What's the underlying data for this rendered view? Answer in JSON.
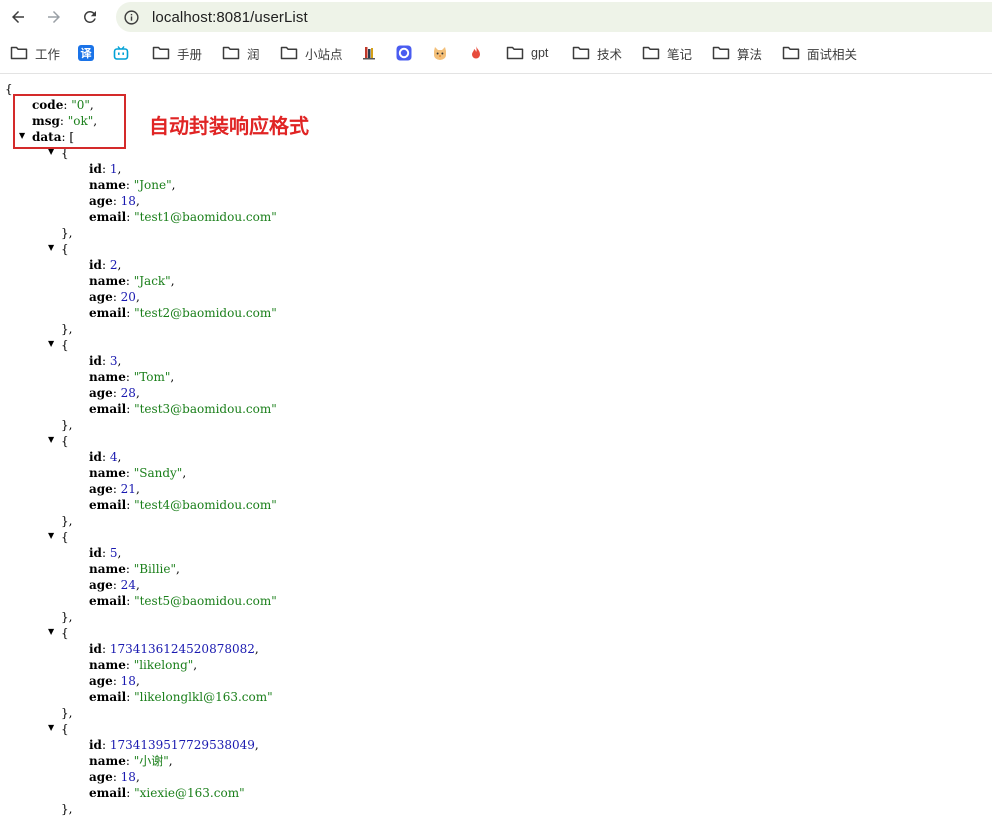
{
  "browser": {
    "url": "localhost:8081/userList"
  },
  "bookmarks": [
    {
      "type": "folder",
      "label": "工作"
    },
    {
      "type": "icon",
      "icon": "translate-icon",
      "glyph": "译",
      "color": "#1a73e8"
    },
    {
      "type": "icon",
      "icon": "bilibili-icon",
      "glyph": "",
      "color": "#00a1d6"
    },
    {
      "type": "folder",
      "label": "手册"
    },
    {
      "type": "folder",
      "label": "润"
    },
    {
      "type": "folder",
      "label": "小站点"
    },
    {
      "type": "icon",
      "icon": "books-icon",
      "glyph": "",
      "color": "#c0392b"
    },
    {
      "type": "icon",
      "icon": "circle-app-icon",
      "glyph": "",
      "color": "#4a5cf0"
    },
    {
      "type": "icon",
      "icon": "cat-icon",
      "glyph": "",
      "color": "#e67e22"
    },
    {
      "type": "icon",
      "icon": "flame-icon",
      "glyph": "",
      "color": "#e74c3c"
    },
    {
      "type": "folder",
      "label": "gpt"
    },
    {
      "type": "folder",
      "label": "技术"
    },
    {
      "type": "folder",
      "label": "笔记"
    },
    {
      "type": "folder",
      "label": "算法"
    },
    {
      "type": "folder",
      "label": "面试相关"
    }
  ],
  "annotation": {
    "text": "自动封装响应格式",
    "color": "#e02424"
  },
  "response": {
    "code": "0",
    "msg": "ok",
    "data": [
      {
        "id": "1",
        "name": "Jone",
        "age": "18",
        "email": "test1@baomidou.com"
      },
      {
        "id": "2",
        "name": "Jack",
        "age": "20",
        "email": "test2@baomidou.com"
      },
      {
        "id": "3",
        "name": "Tom",
        "age": "28",
        "email": "test3@baomidou.com"
      },
      {
        "id": "4",
        "name": "Sandy",
        "age": "21",
        "email": "test4@baomidou.com"
      },
      {
        "id": "5",
        "name": "Billie",
        "age": "24",
        "email": "test5@baomidou.com"
      },
      {
        "id": "1734136124520878082",
        "name": "likelong",
        "age": "18",
        "email": "likelonglkl@163.com"
      },
      {
        "id": "1734139517729538049",
        "name": "小谢",
        "age": "18",
        "email": "xiexie@163.com"
      }
    ]
  }
}
